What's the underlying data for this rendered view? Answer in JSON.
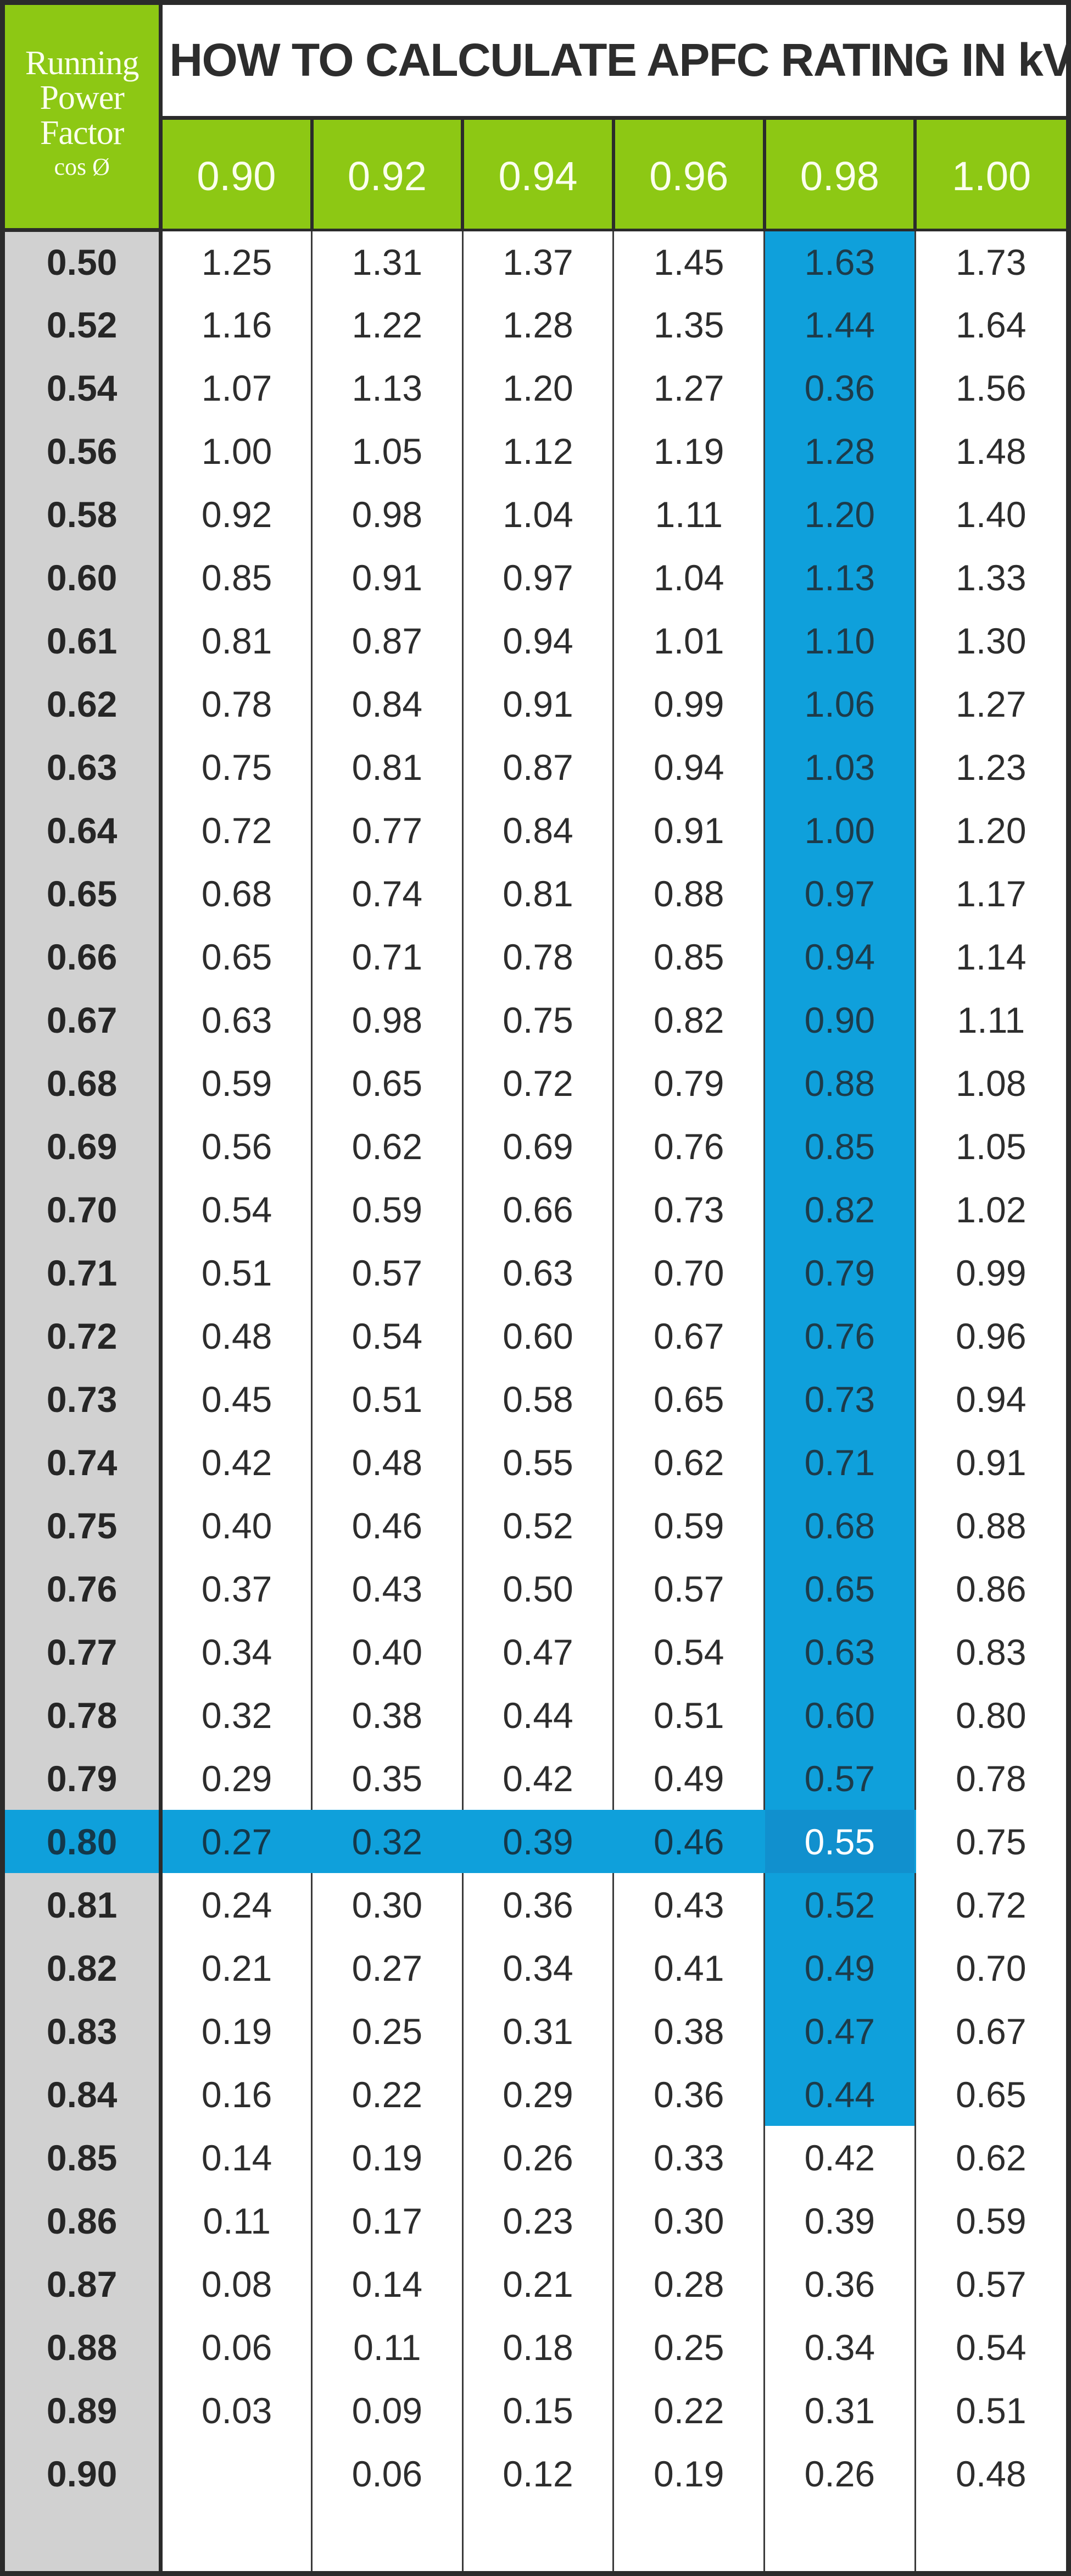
{
  "document": {
    "title": "HOW TO CALCULATE APFC RATING IN kVAr",
    "corner_header": {
      "line1": "Running",
      "line2": "Power",
      "line3": "Factor",
      "line4": "cos Ø"
    }
  },
  "colors": {
    "header_green": "#8DC814",
    "highlight_blue": "#0FA0DB",
    "cross_blue": "#1190CE",
    "label_gray": "#D1D1D1",
    "frame_dark": "#2B2B2B",
    "text_dark": "#2D2D2D",
    "header_text": "#FBFFEE"
  },
  "table": {
    "row_header_label": "Running Power Factor cos Ø",
    "columns": [
      "0.90",
      "0.92",
      "0.94",
      "0.96",
      "0.98",
      "1.00"
    ],
    "highlighted_column": "0.98",
    "highlighted_column_index": 4,
    "highlighted_row": "0.80",
    "highlighted_row_index": 29,
    "intersection_value": "0.55",
    "rows": [
      {
        "pf": "0.50",
        "values": [
          "1.25",
          "1.31",
          "1.37",
          "1.45",
          "1.63",
          "1.73"
        ]
      },
      {
        "pf": "0.52",
        "values": [
          "1.16",
          "1.22",
          "1.28",
          "1.35",
          "1.44",
          "1.64"
        ]
      },
      {
        "pf": "0.54",
        "values": [
          "1.07",
          "1.13",
          "1.20",
          "1.27",
          "0.36",
          "1.56"
        ]
      },
      {
        "pf": "0.56",
        "values": [
          "1.00",
          "1.05",
          "1.12",
          "1.19",
          "1.28",
          "1.48"
        ]
      },
      {
        "pf": "0.58",
        "values": [
          "0.92",
          "0.98",
          "1.04",
          "1.11",
          "1.20",
          "1.40"
        ]
      },
      {
        "pf": "0.60",
        "values": [
          "0.85",
          "0.91",
          "0.97",
          "1.04",
          "1.13",
          "1.33"
        ]
      },
      {
        "pf": "0.61",
        "values": [
          "0.81",
          "0.87",
          "0.94",
          "1.01",
          "1.10",
          "1.30"
        ]
      },
      {
        "pf": "0.62",
        "values": [
          "0.78",
          "0.84",
          "0.91",
          "0.99",
          "1.06",
          "1.27"
        ]
      },
      {
        "pf": "0.63",
        "values": [
          "0.75",
          "0.81",
          "0.87",
          "0.94",
          "1.03",
          "1.23"
        ]
      },
      {
        "pf": "0.64",
        "values": [
          "0.72",
          "0.77",
          "0.84",
          "0.91",
          "1.00",
          "1.20"
        ]
      },
      {
        "pf": "0.65",
        "values": [
          "0.68",
          "0.74",
          "0.81",
          "0.88",
          "0.97",
          "1.17"
        ]
      },
      {
        "pf": "0.66",
        "values": [
          "0.65",
          "0.71",
          "0.78",
          "0.85",
          "0.94",
          "1.14"
        ]
      },
      {
        "pf": "0.67",
        "values": [
          "0.63",
          "0.98",
          "0.75",
          "0.82",
          "0.90",
          "1.11"
        ]
      },
      {
        "pf": "0.68",
        "values": [
          "0.59",
          "0.65",
          "0.72",
          "0.79",
          "0.88",
          "1.08"
        ]
      },
      {
        "pf": "0.69",
        "values": [
          "0.56",
          "0.62",
          "0.69",
          "0.76",
          "0.85",
          "1.05"
        ]
      },
      {
        "pf": "0.70",
        "values": [
          "0.54",
          "0.59",
          "0.66",
          "0.73",
          "0.82",
          "1.02"
        ]
      },
      {
        "pf": "0.71",
        "values": [
          "0.51",
          "0.57",
          "0.63",
          "0.70",
          "0.79",
          "0.99"
        ]
      },
      {
        "pf": "0.72",
        "values": [
          "0.48",
          "0.54",
          "0.60",
          "0.67",
          "0.76",
          "0.96"
        ]
      },
      {
        "pf": "0.73",
        "values": [
          "0.45",
          "0.51",
          "0.58",
          "0.65",
          "0.73",
          "0.94"
        ]
      },
      {
        "pf": "0.74",
        "values": [
          "0.42",
          "0.48",
          "0.55",
          "0.62",
          "0.71",
          "0.91"
        ]
      },
      {
        "pf": "0.75",
        "values": [
          "0.40",
          "0.46",
          "0.52",
          "0.59",
          "0.68",
          "0.88"
        ]
      },
      {
        "pf": "0.76",
        "values": [
          "0.37",
          "0.43",
          "0.50",
          "0.57",
          "0.65",
          "0.86"
        ]
      },
      {
        "pf": "0.77",
        "values": [
          "0.34",
          "0.40",
          "0.47",
          "0.54",
          "0.63",
          "0.83"
        ]
      },
      {
        "pf": "0.78",
        "values": [
          "0.32",
          "0.38",
          "0.44",
          "0.51",
          "0.60",
          "0.80"
        ]
      },
      {
        "pf": "0.79",
        "values": [
          "0.29",
          "0.35",
          "0.42",
          "0.49",
          "0.57",
          "0.78"
        ]
      },
      {
        "pf": "0.80",
        "values": [
          "0.27",
          "0.32",
          "0.39",
          "0.46",
          "0.55",
          "0.75"
        ]
      },
      {
        "pf": "0.81",
        "values": [
          "0.24",
          "0.30",
          "0.36",
          "0.43",
          "0.52",
          "0.72"
        ]
      },
      {
        "pf": "0.82",
        "values": [
          "0.21",
          "0.27",
          "0.34",
          "0.41",
          "0.49",
          "0.70"
        ]
      },
      {
        "pf": "0.83",
        "values": [
          "0.19",
          "0.25",
          "0.31",
          "0.38",
          "0.47",
          "0.67"
        ]
      },
      {
        "pf": "0.84",
        "values": [
          "0.16",
          "0.22",
          "0.29",
          "0.36",
          "0.44",
          "0.65"
        ]
      },
      {
        "pf": "0.85",
        "values": [
          "0.14",
          "0.19",
          "0.26",
          "0.33",
          "0.42",
          "0.62"
        ]
      },
      {
        "pf": "0.86",
        "values": [
          "0.11",
          "0.17",
          "0.23",
          "0.30",
          "0.39",
          "0.59"
        ]
      },
      {
        "pf": "0.87",
        "values": [
          "0.08",
          "0.14",
          "0.21",
          "0.28",
          "0.36",
          "0.57"
        ]
      },
      {
        "pf": "0.88",
        "values": [
          "0.06",
          "0.11",
          "0.18",
          "0.25",
          "0.34",
          "0.54"
        ]
      },
      {
        "pf": "0.89",
        "values": [
          "0.03",
          "0.09",
          "0.15",
          "0.22",
          "0.31",
          "0.51"
        ]
      },
      {
        "pf": "0.90",
        "values": [
          "",
          "0.06",
          "0.12",
          "0.19",
          "0.26",
          "0.48"
        ]
      },
      {
        "pf": "",
        "values": [
          "",
          "",
          "",
          "",
          "",
          ""
        ]
      }
    ]
  }
}
